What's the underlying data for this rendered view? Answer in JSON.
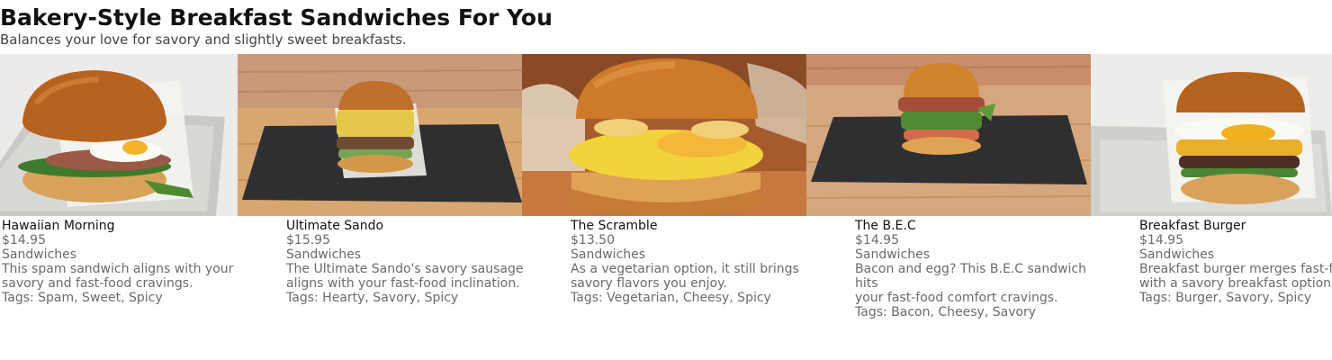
{
  "page": {
    "title": "Bakery-Style Breakfast Sandwiches For You",
    "subtitle": "Balances your love for savory and slightly sweet breakfasts."
  },
  "products": [
    {
      "name": "Hawaiian Morning",
      "price": "$14.95",
      "category": "Sandwiches",
      "description_line1": "This spam sandwich aligns with your",
      "description_line2": "savory and fast-food cravings.",
      "tags_label": "Tags: Spam, Sweet, Spicy",
      "image": "sandwich-photo"
    },
    {
      "name": "Ultimate Sando",
      "price": "$15.95",
      "category": "Sandwiches",
      "description_line1": "The Ultimate Sando's savory sausage",
      "description_line2": "aligns with your fast-food inclination.",
      "tags_label": "Tags: Hearty, Savory, Spicy",
      "image": "sandwich-photo"
    },
    {
      "name": "The Scramble",
      "price": "$13.50",
      "category": "Sandwiches",
      "description_line1": "As a vegetarian option, it still brings",
      "description_line2": "savory flavors you enjoy.",
      "tags_label": "Tags: Vegetarian, Cheesy, Spicy",
      "image": "sandwich-photo"
    },
    {
      "name": "The B.E.C",
      "price": "$14.95",
      "category": "Sandwiches",
      "description_line1": "Bacon and egg? This B.E.C sandwich hits",
      "description_line2": "your fast-food comfort cravings.",
      "tags_label": "Tags: Bacon, Cheesy, Savory",
      "image": "sandwich-photo"
    },
    {
      "name": "Breakfast Burger",
      "price": "$14.95",
      "category": "Sandwiches",
      "description_line1": "Breakfast burger merges fast-food",
      "description_line2": "with a savory breakfast option.",
      "tags_label": "Tags: Burger, Savory, Spicy",
      "image": "sandwich-photo"
    }
  ]
}
